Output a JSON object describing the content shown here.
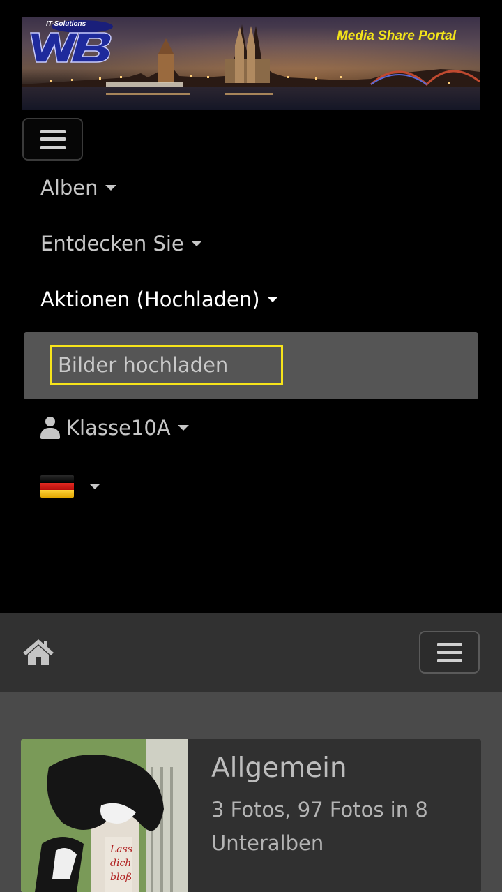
{
  "banner": {
    "logo_tagline": "IT-Solutions",
    "logo_letters": "WB",
    "title": "Media Share Portal"
  },
  "nav": {
    "items": [
      {
        "label": "Alben",
        "active": false
      },
      {
        "label": "Entdecken Sie",
        "active": false
      },
      {
        "label": "Aktionen (Hochladen)",
        "active": true
      }
    ],
    "dropdown": {
      "item": "Bilder hochladen"
    },
    "user": {
      "label": "Klasse10A",
      "icon": "user-icon"
    },
    "language": {
      "flag": "germany-flag",
      "colors": [
        "#000000",
        "#dd0000",
        "#ffce00"
      ]
    }
  },
  "navbar2": {
    "home_icon": "home-icon",
    "menu_icon": "hamburger-icon"
  },
  "album": {
    "title": "Allgemein",
    "meta": "3 Fotos, 97 Fotos in 8 Unteralben",
    "thumb_sign_text": "Lass dich bloß"
  },
  "colors": {
    "accent_focus": "#f7e41b",
    "banner_title": "#f2e41a",
    "dropdown_bg": "#555555",
    "navbar_bg": "#313131"
  }
}
